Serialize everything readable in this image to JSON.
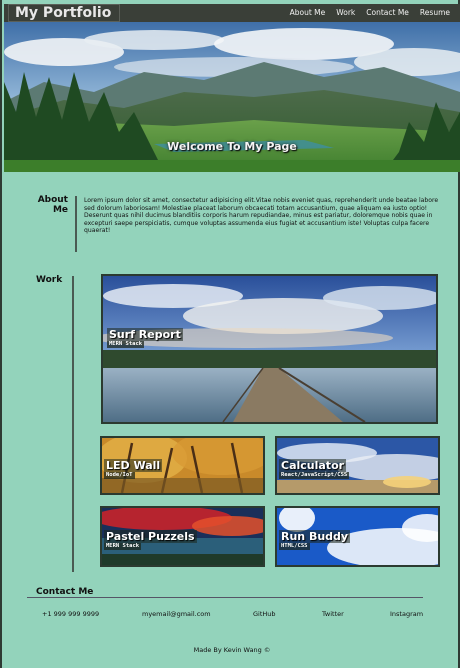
{
  "header": {
    "brand": "My Portfolio",
    "nav": [
      "About Me",
      "Work",
      "Contact Me",
      "Resume"
    ]
  },
  "hero": {
    "title": "Welcome To My Page"
  },
  "about": {
    "label": "About Me",
    "text": "Lorem ipsum dolor sit amet, consectetur adipisicing elit.Vitae nobis eveniet quas, reprehenderit unde beatae labore sed dolorum laboriosam! Molestiae placeat laborum obcaecati totam accusantium, quae aliquam ea iusto optio! Deserunt quas nihil ducimus blanditiis corporis harum repudiandae, minus est pariatur, doloremque nobis quae in excepturi saepe perspiciatis, cumque voluptas assumenda eius fugiat et accusantium iste! Voluptas culpa facere quaerat!"
  },
  "work": {
    "label": "Work",
    "projects": [
      {
        "title": "Surf Report",
        "tags": "MERN Stack"
      },
      {
        "title": "LED Wall",
        "tags": "Node/IoT"
      },
      {
        "title": "Calculator",
        "tags": "React/JavaScript/CSS"
      },
      {
        "title": "Pastel Puzzels",
        "tags": "MERN Stack"
      },
      {
        "title": "Run Buddy",
        "tags": "HTML/CSS"
      }
    ]
  },
  "contact": {
    "label": "Contact Me",
    "phone": "+1 999 999 9999",
    "email": "myemail@gmail.com",
    "github": "GitHub",
    "twitter": "Twitter",
    "instagram": "Instagram"
  },
  "footer": {
    "text": "Made By Kevin Wang ©"
  },
  "colors": {
    "background": "#93d3bb",
    "header": "#3a3f38",
    "card_border": "#2b3a30"
  }
}
